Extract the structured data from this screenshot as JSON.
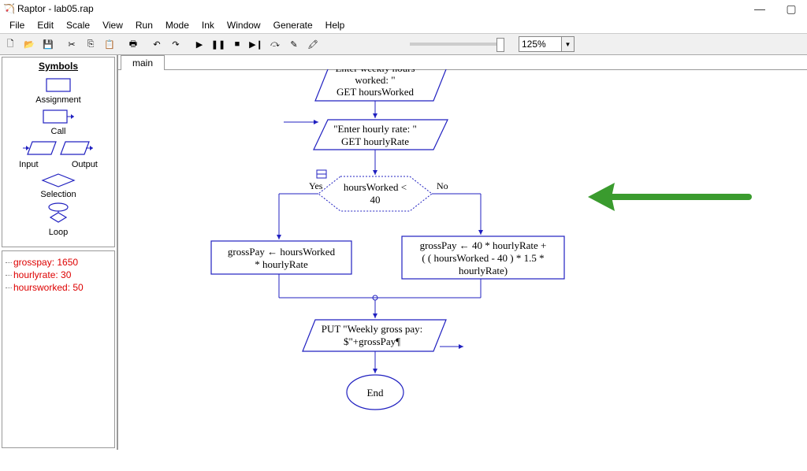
{
  "window": {
    "title": "Raptor - lab05.rap"
  },
  "menu": [
    "File",
    "Edit",
    "Scale",
    "View",
    "Run",
    "Mode",
    "Ink",
    "Window",
    "Generate",
    "Help"
  ],
  "toolbar": {
    "zoom": "125%"
  },
  "sidebar": {
    "symbols_title": "Symbols",
    "assignment": "Assignment",
    "call": "Call",
    "input": "Input",
    "output": "Output",
    "selection": "Selection",
    "loop": "Loop"
  },
  "variables": [
    "grosspay: 1650",
    "hourlyrate: 30",
    "hoursworked: 50"
  ],
  "tab": "main",
  "flow": {
    "input1_line1": "Enter weekly hours",
    "input1_line2": "worked: \"",
    "input1_line3": "GET hoursWorked",
    "input2_line1": "\"Enter hourly rate: \"",
    "input2_line2": "GET hourlyRate",
    "decision": "hoursWorked < 40",
    "yes": "Yes",
    "no": "No",
    "assign_left_line1": "grossPay ← hoursWorked",
    "assign_left_line2": "* hourlyRate",
    "assign_right_line1": "grossPay ← 40 * hourlyRate  +",
    "assign_right_line2": "( ( hoursWorked  - 40 ) * 1.5 *",
    "assign_right_line3": "hourlyRate)",
    "output_line1": "PUT \"Weekly gross pay:",
    "output_line2": "$\"+grossPay¶",
    "end": "End"
  }
}
